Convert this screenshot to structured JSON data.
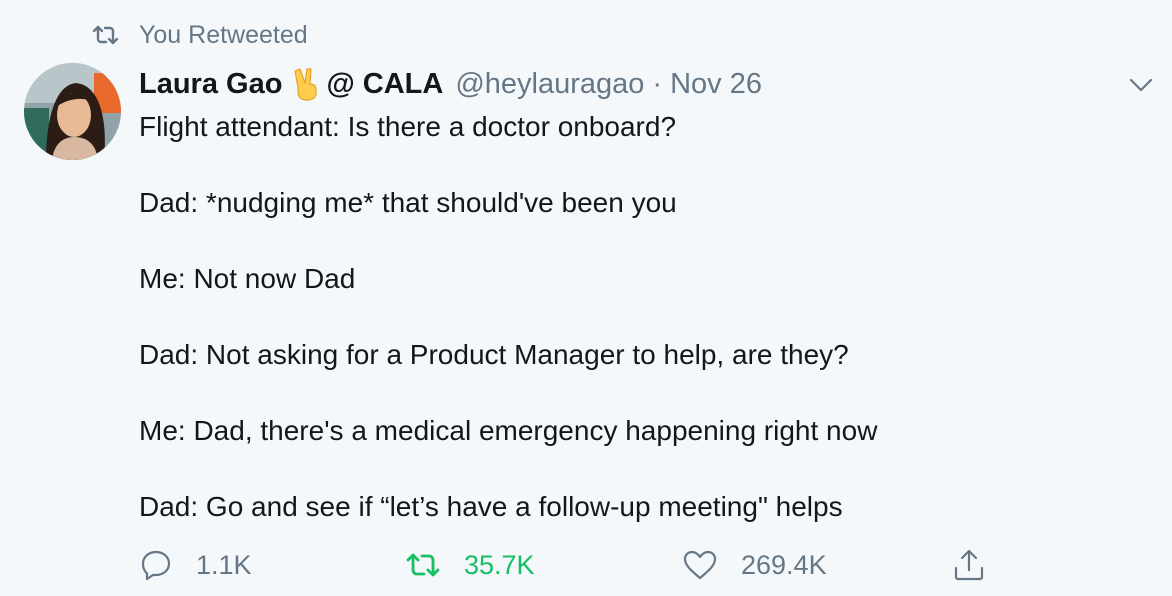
{
  "retweet_context": {
    "icon": "retweet-icon",
    "text": "You Retweeted"
  },
  "author": {
    "name": "Laura Gao",
    "emoji": "victory-hand-emoji",
    "affiliation": "@ CALA",
    "handle": "@heylauragao",
    "separator": "·",
    "date": "Nov 26"
  },
  "menu": {
    "icon": "chevron-down-icon"
  },
  "body_lines": [
    "Flight attendant: Is there a doctor onboard?",
    "Dad: *nudging me* that should've been you",
    "Me: Not now Dad",
    "Dad: Not asking for a Product Manager to help, are they?",
    "Me: Dad, there's a medical emergency happening right now",
    "Dad: Go and see if “let’s have a follow-up meeting\" helps"
  ],
  "actions": {
    "reply": {
      "icon": "reply-icon",
      "count": "1.1K"
    },
    "retweet": {
      "icon": "retweet-icon",
      "count": "35.7K",
      "active_color": "#17bf63"
    },
    "like": {
      "icon": "heart-icon",
      "count": "269.4K"
    },
    "share": {
      "icon": "share-icon"
    }
  },
  "colors": {
    "background": "#f5f8fa",
    "text": "#14171a",
    "muted": "#657786",
    "retweet_active": "#17bf63"
  }
}
